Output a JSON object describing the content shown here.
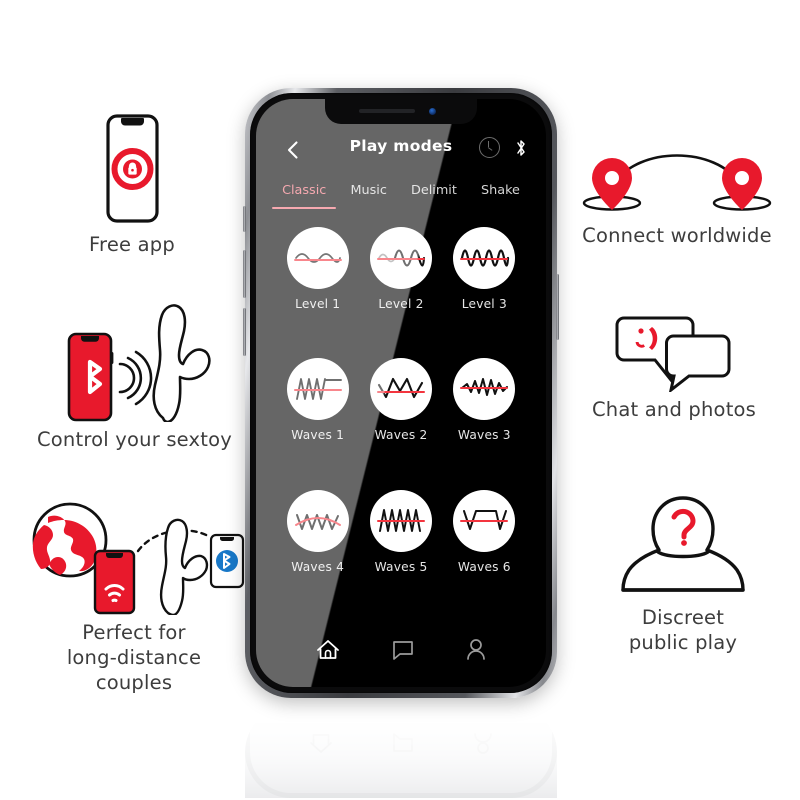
{
  "phone_app": {
    "title": "Play modes",
    "back_icon": "chevron-left-icon",
    "header_icons": [
      "timer-icon",
      "bluetooth-icon"
    ],
    "tabs": [
      {
        "label": "Classic",
        "active": true
      },
      {
        "label": "Music",
        "active": false
      },
      {
        "label": "Delimit",
        "active": false
      },
      {
        "label": "Shake",
        "active": false
      }
    ],
    "active_tab_color": "#f0707c",
    "modes": [
      {
        "label": "Level 1",
        "wave": "sine-low"
      },
      {
        "label": "Level 2",
        "wave": "sine-ramp"
      },
      {
        "label": "Level 3",
        "wave": "sine-dense"
      },
      {
        "label": "Waves 1",
        "wave": "zigzag-plateau"
      },
      {
        "label": "Waves 2",
        "wave": "triangle-peaks"
      },
      {
        "label": "Waves 3",
        "wave": "jagged-rise"
      },
      {
        "label": "Waves 4",
        "wave": "zigzag-arc"
      },
      {
        "label": "Waves 5",
        "wave": "sawtooth-dense"
      },
      {
        "label": "Waves 6",
        "wave": "v-plateau-v"
      }
    ],
    "nav_items": [
      {
        "icon": "home-icon",
        "active": true
      },
      {
        "icon": "chat-icon",
        "active": false
      },
      {
        "icon": "profile-icon",
        "active": false
      }
    ]
  },
  "features_left": [
    {
      "caption": "Free app",
      "icon": "phone-app-logo-icon"
    },
    {
      "caption": "Control your sextoy",
      "icon": "phone-bluetooth-toy-icon"
    },
    {
      "caption": "Perfect for\nlong-distance\ncouples",
      "icon": "globe-phones-toy-icon"
    }
  ],
  "features_right": [
    {
      "caption": "Connect worldwide",
      "icon": "map-pins-icon"
    },
    {
      "caption": "Chat and photos",
      "icon": "chat-bubbles-icon"
    },
    {
      "caption": "Discreet\npublic play",
      "icon": "anonymous-person-icon"
    }
  ],
  "colors": {
    "accent_red": "#e8192c",
    "accent_pink": "#f0707c",
    "bluetooth_blue": "#1878c8",
    "text_gray": "#3d3d3d"
  }
}
